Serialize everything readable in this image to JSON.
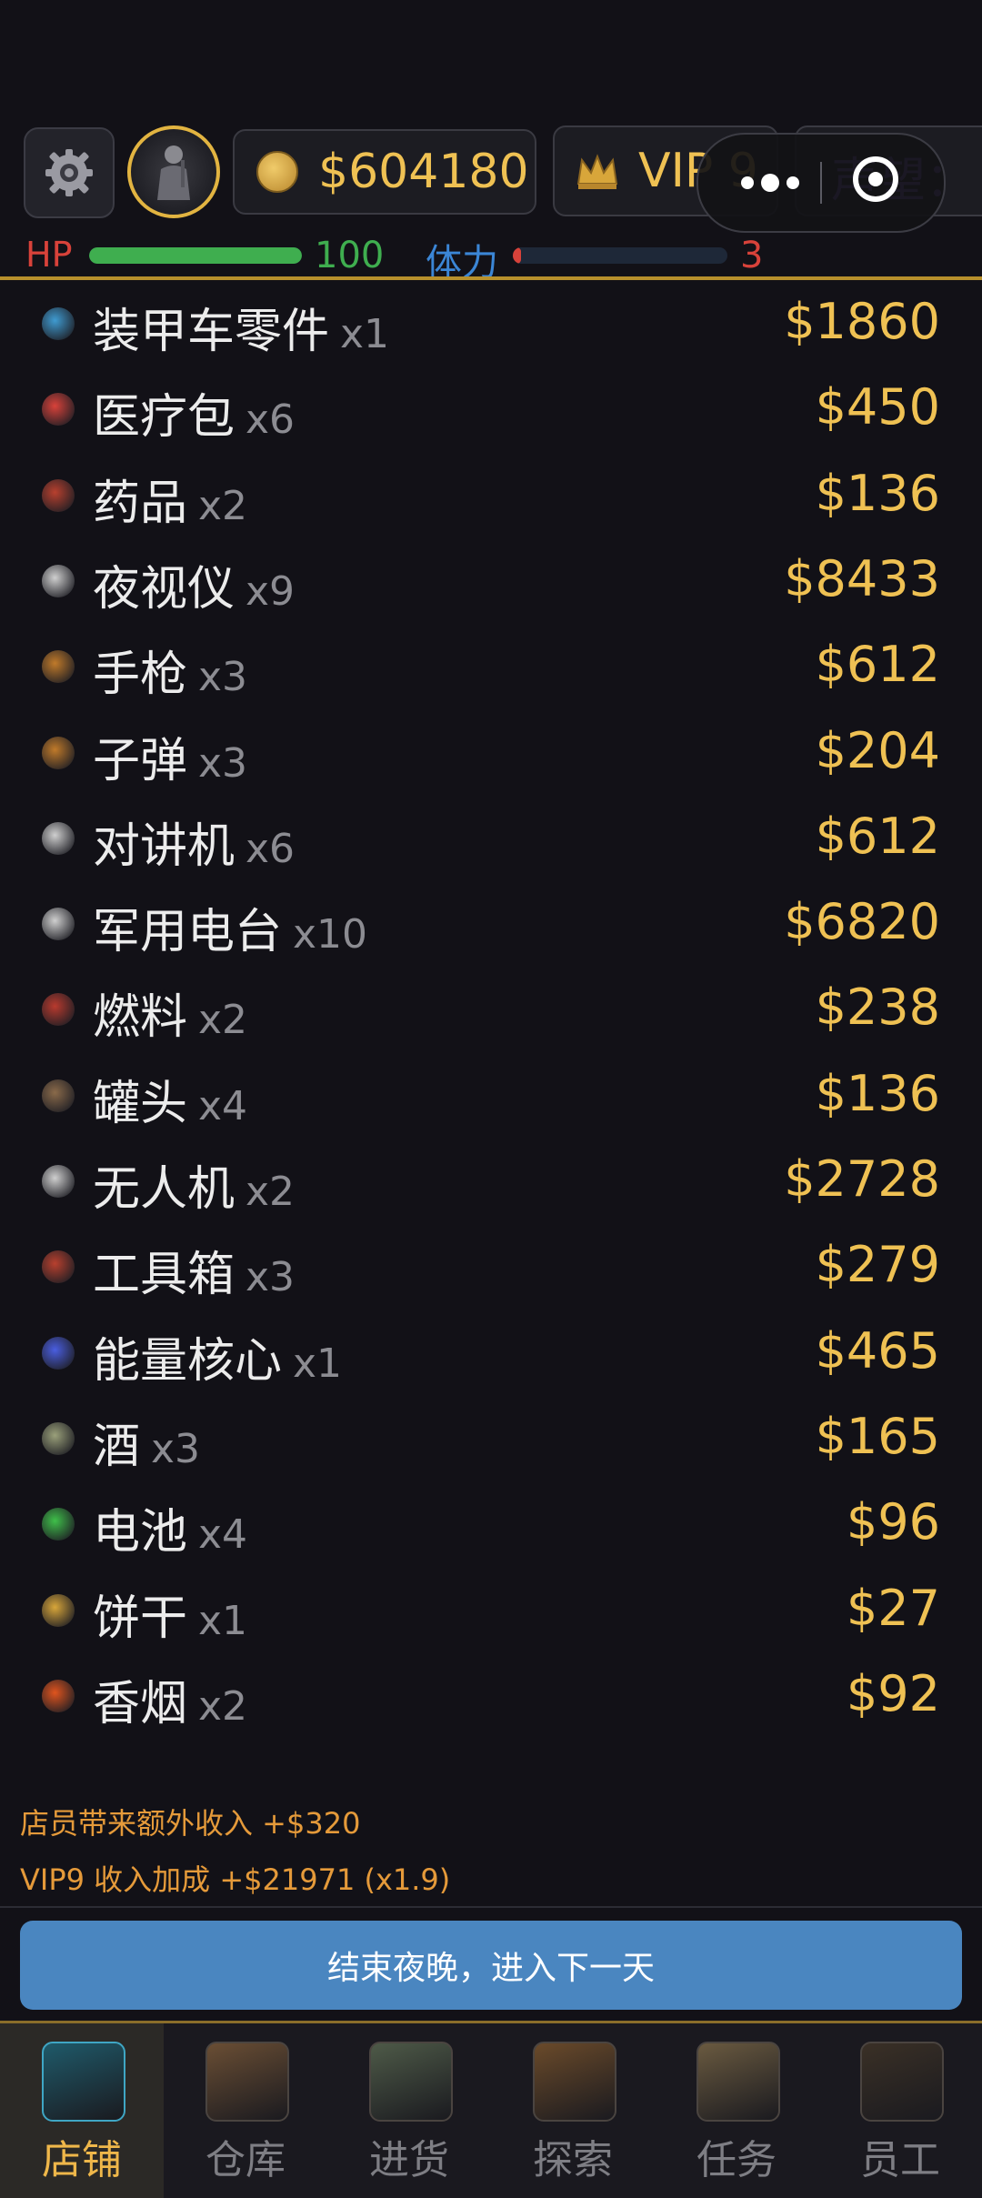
{
  "header": {
    "money": "$604180",
    "vip": "VIP 9",
    "reputation": "声望：",
    "hp_label": "HP",
    "hp_value": "100",
    "hp_fraction": 1.0,
    "stamina_label": "体力",
    "stamina_value": "3",
    "stamina_fraction": 0.03
  },
  "items": [
    {
      "name": "装甲车零件",
      "qty": "x1",
      "price": "$1860",
      "icon": "armored-part-icon",
      "color": "#3f9bd1"
    },
    {
      "name": "医疗包",
      "qty": "x6",
      "price": "$450",
      "icon": "medkit-icon",
      "color": "#d8423a"
    },
    {
      "name": "药品",
      "qty": "x2",
      "price": "$136",
      "icon": "pill-icon",
      "color": "#b8402e"
    },
    {
      "name": "夜视仪",
      "qty": "x9",
      "price": "$8433",
      "icon": "night-vision-icon",
      "color": "#cfcfcf"
    },
    {
      "name": "手枪",
      "qty": "x3",
      "price": "$612",
      "icon": "pistol-icon",
      "color": "#c07a2a"
    },
    {
      "name": "子弹",
      "qty": "x3",
      "price": "$204",
      "icon": "bullet-icon",
      "color": "#c07a2a"
    },
    {
      "name": "对讲机",
      "qty": "x6",
      "price": "$612",
      "icon": "walkie-talkie-icon",
      "color": "#cfcfcf"
    },
    {
      "name": "军用电台",
      "qty": "x10",
      "price": "$6820",
      "icon": "radio-icon",
      "color": "#cfcfcf"
    },
    {
      "name": "燃料",
      "qty": "x2",
      "price": "$238",
      "icon": "fuel-icon",
      "color": "#b83a2e"
    },
    {
      "name": "罐头",
      "qty": "x4",
      "price": "$136",
      "icon": "can-icon",
      "color": "#8a6a4a"
    },
    {
      "name": "无人机",
      "qty": "x2",
      "price": "$2728",
      "icon": "drone-icon",
      "color": "#cfcfcf"
    },
    {
      "name": "工具箱",
      "qty": "x3",
      "price": "$279",
      "icon": "toolbox-icon",
      "color": "#b8402e"
    },
    {
      "name": "能量核心",
      "qty": "x1",
      "price": "$465",
      "icon": "energy-core-icon",
      "color": "#4a5ee0"
    },
    {
      "name": "酒",
      "qty": "x3",
      "price": "$165",
      "icon": "liquor-icon",
      "color": "#9aa07a"
    },
    {
      "name": "电池",
      "qty": "x4",
      "price": "$96",
      "icon": "battery-icon",
      "color": "#3fbf4a"
    },
    {
      "name": "饼干",
      "qty": "x1",
      "price": "$27",
      "icon": "biscuit-icon",
      "color": "#d8a63a"
    },
    {
      "name": "香烟",
      "qty": "x2",
      "price": "$92",
      "icon": "cigarette-icon",
      "color": "#e0541e"
    }
  ],
  "summary": {
    "staff_income": "店员带来额外收入 +$320",
    "vip_bonus": "VIP9 收入加成 +$21971 (x1.9)"
  },
  "end_button": "结束夜晚，进入下一天",
  "nav": [
    {
      "label": "店铺",
      "icon": "shop-icon",
      "active": true,
      "color": "#1f5a6a"
    },
    {
      "label": "仓库",
      "icon": "warehouse-icon",
      "active": false,
      "color": "#6a4e34"
    },
    {
      "label": "进货",
      "icon": "supply-truck-icon",
      "active": false,
      "color": "#4e5a48"
    },
    {
      "label": "探索",
      "icon": "explore-map-icon",
      "active": false,
      "color": "#6a4a2a"
    },
    {
      "label": "任务",
      "icon": "task-clipboard-icon",
      "active": false,
      "color": "#6a5a40"
    },
    {
      "label": "员工",
      "icon": "staff-icon",
      "active": false,
      "color": "#3a3026"
    }
  ]
}
